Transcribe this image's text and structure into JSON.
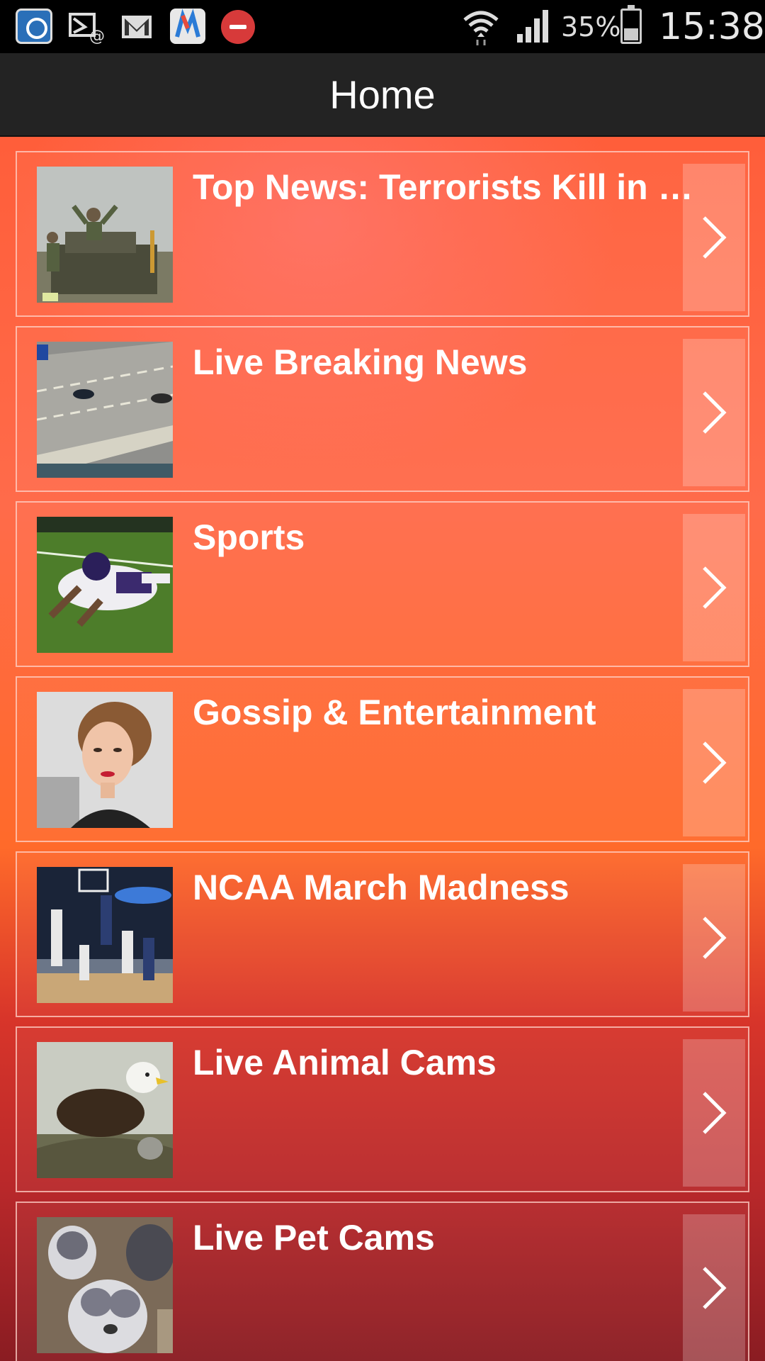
{
  "status_bar": {
    "battery": "35%",
    "time": "15:38",
    "icons": [
      "app-notification-icon",
      "missed-call-email-icon",
      "gmail-icon",
      "email-app-icon",
      "do-not-disturb-icon",
      "wifi-icon",
      "signal-icon",
      "battery-icon"
    ]
  },
  "header": {
    "title": "Home"
  },
  "items": [
    {
      "label": "Top News: Terrorists Kill in Tunisia Museum Attack",
      "thumb": "soldiers-thumbnail"
    },
    {
      "label": "Live Breaking News",
      "thumb": "highway-chase-thumbnail"
    },
    {
      "label": "Sports",
      "thumb": "football-player-thumbnail"
    },
    {
      "label": "Gossip & Entertainment",
      "thumb": "celebrity-thumbnail"
    },
    {
      "label": "NCAA March Madness",
      "thumb": "basketball-thumbnail"
    },
    {
      "label": "Live Animal Cams",
      "thumb": "eagle-nest-thumbnail"
    },
    {
      "label": "Live Pet Cams",
      "thumb": "puppies-thumbnail"
    }
  ],
  "colors": {
    "title_bar": "#232323",
    "gradient_top": "#ff5e3a",
    "gradient_bottom": "#8a1c22"
  }
}
